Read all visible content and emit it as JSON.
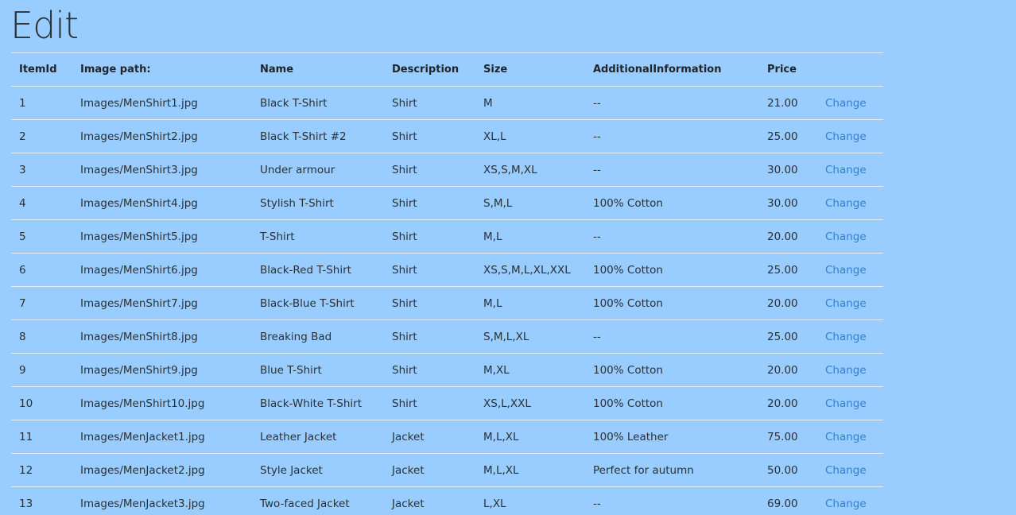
{
  "page": {
    "title": "Edit"
  },
  "table": {
    "headers": [
      "ItemId",
      "Image path:",
      "Name",
      "Description",
      "Size",
      "AdditionalInformation",
      "Price",
      ""
    ],
    "action_label": "Change",
    "rows": [
      {
        "id": "1",
        "image": "Images/MenShirt1.jpg",
        "name": "Black T-Shirt",
        "description": "Shirt",
        "size": "M",
        "info": "--",
        "price": "21.00"
      },
      {
        "id": "2",
        "image": "Images/MenShirt2.jpg",
        "name": "Black T-Shirt #2",
        "description": "Shirt",
        "size": "XL,L",
        "info": "--",
        "price": "25.00"
      },
      {
        "id": "3",
        "image": "Images/MenShirt3.jpg",
        "name": "Under armour",
        "description": "Shirt",
        "size": "XS,S,M,XL",
        "info": "--",
        "price": "30.00"
      },
      {
        "id": "4",
        "image": "Images/MenShirt4.jpg",
        "name": "Stylish T-Shirt",
        "description": "Shirt",
        "size": "S,M,L",
        "info": "100% Cotton",
        "price": "30.00"
      },
      {
        "id": "5",
        "image": "Images/MenShirt5.jpg",
        "name": "T-Shirt",
        "description": "Shirt",
        "size": "M,L",
        "info": "--",
        "price": "20.00"
      },
      {
        "id": "6",
        "image": "Images/MenShirt6.jpg",
        "name": "Black-Red T-Shirt",
        "description": "Shirt",
        "size": "XS,S,M,L,XL,XXL",
        "info": "100% Cotton",
        "price": "25.00"
      },
      {
        "id": "7",
        "image": "Images/MenShirt7.jpg",
        "name": "Black-Blue T-Shirt",
        "description": "Shirt",
        "size": "M,L",
        "info": "100% Cotton",
        "price": "20.00"
      },
      {
        "id": "8",
        "image": "Images/MenShirt8.jpg",
        "name": "Breaking Bad",
        "description": "Shirt",
        "size": "S,M,L,XL",
        "info": "--",
        "price": "25.00"
      },
      {
        "id": "9",
        "image": "Images/MenShirt9.jpg",
        "name": "Blue T-Shirt",
        "description": "Shirt",
        "size": "M,XL",
        "info": "100% Cotton",
        "price": "20.00"
      },
      {
        "id": "10",
        "image": "Images/MenShirt10.jpg",
        "name": "Black-White T-Shirt",
        "description": "Shirt",
        "size": "XS,L,XXL",
        "info": "100% Cotton",
        "price": "20.00"
      },
      {
        "id": "11",
        "image": "Images/MenJacket1.jpg",
        "name": "Leather Jacket",
        "description": "Jacket",
        "size": "M,L,XL",
        "info": "100% Leather",
        "price": "75.00"
      },
      {
        "id": "12",
        "image": "Images/MenJacket2.jpg",
        "name": "Style Jacket",
        "description": "Jacket",
        "size": "M,L,XL",
        "info": "Perfect for autumn",
        "price": "50.00"
      },
      {
        "id": "13",
        "image": "Images/MenJacket3.jpg",
        "name": "Two-faced Jacket",
        "description": "Jacket",
        "size": "L,XL",
        "info": "--",
        "price": "69.00"
      }
    ]
  }
}
